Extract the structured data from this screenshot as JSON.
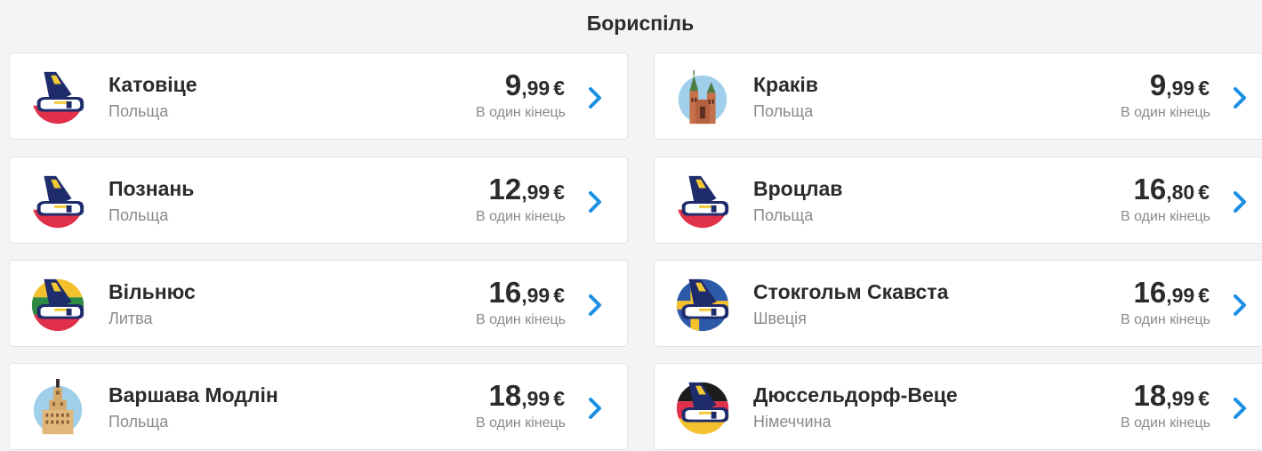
{
  "page": {
    "title": "Бориспіль"
  },
  "common": {
    "oneway_label": "В один кінець",
    "currency": "€"
  },
  "colors": {
    "accent": "#1a8fe3",
    "text": "#2b2b2b",
    "muted": "#8a8a8a",
    "ryanair_navy": "#1f2c6b",
    "ryanair_yellow": "#f1c933"
  },
  "destinations": [
    {
      "city": "Катовіце",
      "country": "Польща",
      "price_int": "9",
      "price_cents": ",99",
      "icon": "ryanair-tail-poland-icon"
    },
    {
      "city": "Краків",
      "country": "Польща",
      "price_int": "9",
      "price_cents": ",99",
      "icon": "krakow-landmark-icon"
    },
    {
      "city": "Познань",
      "country": "Польща",
      "price_int": "12",
      "price_cents": ",99",
      "icon": "ryanair-tail-poland-icon"
    },
    {
      "city": "Вроцлав",
      "country": "Польща",
      "price_int": "16",
      "price_cents": ",80",
      "icon": "ryanair-tail-poland-icon"
    },
    {
      "city": "Вільнюс",
      "country": "Литва",
      "price_int": "16",
      "price_cents": ",99",
      "icon": "ryanair-tail-lithuania-icon"
    },
    {
      "city": "Стокгольм Скавста",
      "country": "Швеція",
      "price_int": "16",
      "price_cents": ",99",
      "icon": "ryanair-tail-sweden-icon"
    },
    {
      "city": "Варшава Модлін",
      "country": "Польща",
      "price_int": "18",
      "price_cents": ",99",
      "icon": "warsaw-palace-icon"
    },
    {
      "city": "Дюссельдорф-Веце",
      "country": "Німеччина",
      "price_int": "18",
      "price_cents": ",99",
      "icon": "ryanair-tail-germany-icon"
    }
  ]
}
